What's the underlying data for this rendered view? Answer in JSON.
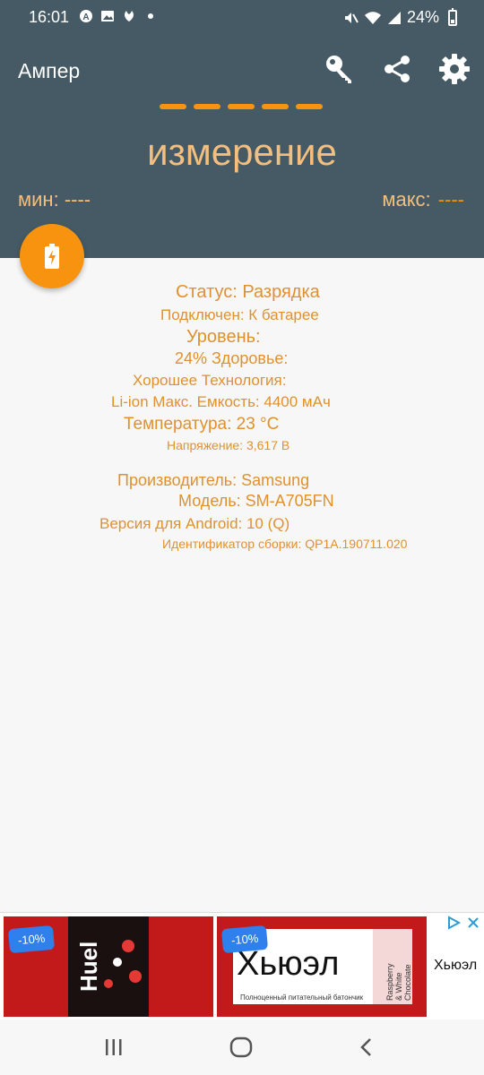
{
  "status_bar": {
    "time": "16:01",
    "battery_percent": "24%",
    "icons_left": [
      "auto-icon",
      "gallery-icon",
      "leaf-icon",
      "dot-icon"
    ],
    "icons_right": [
      "mute-icon",
      "wifi-icon",
      "signal-icon",
      "battery-icon"
    ]
  },
  "header": {
    "title": "Ампер",
    "icons": [
      "key-icon",
      "share-icon",
      "gear-icon"
    ],
    "measure_label": "измерение",
    "min_label": "мин:",
    "min_value": "----",
    "max_label": "макс:",
    "max_value": "----",
    "accent_color": "#f7930f",
    "bg_color": "#455a64"
  },
  "fab": {
    "icon": "battery-charging-icon"
  },
  "info": {
    "status": "Статус: Разрядка",
    "connected": "Подключен: К батарее",
    "level_label": "Уровень:",
    "level_health": "24% Здоровье:",
    "health_tech": "Хорошее Технология:",
    "tech_capacity": "Li-ion Макс. Емкость: 4400 мАч",
    "temperature": "Температура: 23 °C",
    "voltage": "Напряжение: 3,617 В",
    "manufacturer": "Производитель: Samsung",
    "model": "Модель: SM-A705FN",
    "android_version": "Версия для Android: 10 (Q)",
    "build_id": "Идентификатор сборки: QP1A.190711.020"
  },
  "ad": {
    "discount_1": "-10%",
    "product_name": "Huel",
    "discount_2": "-10%",
    "bar_title": "Хьюэл",
    "bar_subtitle": "Полноценный питательный батончик",
    "bar_flavor": "Raspberry & White Chocolate",
    "side_text": "Хьюэл"
  },
  "nav": {
    "buttons": [
      "recents-button",
      "home-button",
      "back-button"
    ]
  }
}
